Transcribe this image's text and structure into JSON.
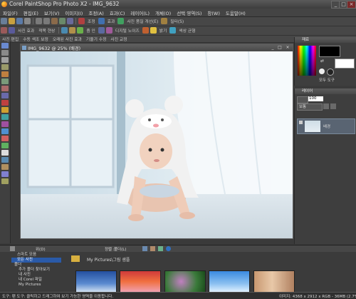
{
  "window": {
    "title": "Corel PaintShop Pro Photo X2 - IMG_9632"
  },
  "menu": [
    "파일(F)",
    "편집(E)",
    "보기(V)",
    "이미지(I)",
    "조정(A)",
    "효과(C)",
    "레이어(L)",
    "개체(O)",
    "선택 영역(S)",
    "창(W)",
    "도움말(H)"
  ],
  "toolbar1": {
    "labels": [
      "조정",
      "효과",
      "사진 품질 개선(E)",
      "필터(S)"
    ]
  },
  "toolbar2": {
    "labels": [
      "사진 효과",
      "적목 현상",
      "가우시안 흐림",
      "돌출",
      "줌 인",
      "흐림 효과",
      "디지털 노이즈",
      "손상 교정",
      "밝기",
      "색상 균형"
    ]
  },
  "toolbar3": {
    "labels": [
      "사진 편집",
      "수동 색조 보정",
      "오래된 사진 효과",
      "기울기 수정",
      "사진 교정"
    ],
    "zoom_value": "25"
  },
  "document": {
    "title": "IMG_9632 @ 25% (배경)"
  },
  "layers": {
    "title": "레이어",
    "opacity": "100",
    "blend": "보통",
    "layer_name": "배경"
  },
  "materials": {
    "title": "재료",
    "label": "모두 도구"
  },
  "organizer": {
    "tree": [
      "스마트 모음",
      "모든 사진",
      "폴더",
      "추가 폴더 찾아보기",
      "내 사진",
      "내 Corel 파일",
      "My Pictures"
    ],
    "path": "My Pictures\\그림 샘플",
    "sort_label": "정렬 :",
    "sort_value": "폴더(L)",
    "view_label": "위(D)"
  },
  "status": {
    "left": "도구: 팬 도구: 클릭하고 드래그하여 보기 가능한 영역을 이동합니다.",
    "right": "이미지: 4368 x 2912 x RGB - 36MB (2.7%)"
  },
  "colors": {
    "bg": "#3a3a3a",
    "accent_blue": "#2a5aa8",
    "panel_title": "#5c5c5c"
  }
}
